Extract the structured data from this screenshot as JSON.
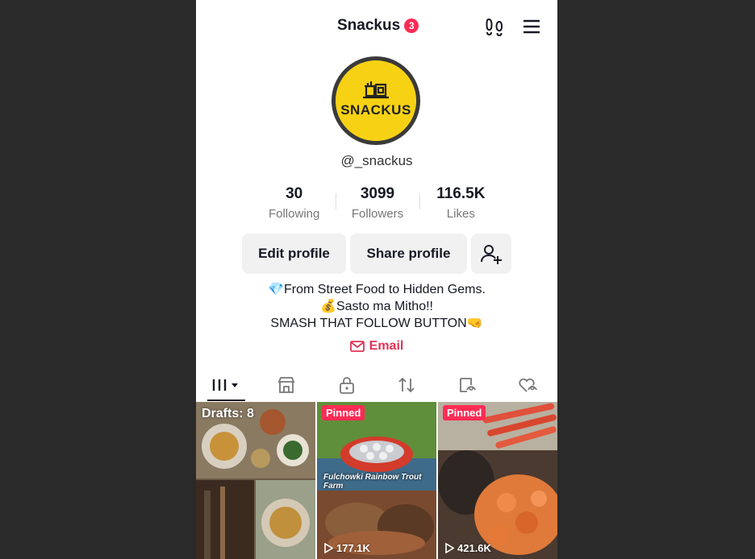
{
  "header": {
    "title": "Snackus",
    "notification_count": "3"
  },
  "profile": {
    "avatar_text": "SNACKUS",
    "handle": "@_snackus",
    "stats": [
      {
        "value": "30",
        "label": "Following"
      },
      {
        "value": "3099",
        "label": "Followers"
      },
      {
        "value": "116.5K",
        "label": "Likes"
      }
    ],
    "bio": [
      "💎From Street Food to Hidden Gems.",
      "💰Sasto ma Mitho!!",
      "SMASH THAT FOLLOW BUTTON🤜"
    ],
    "email_label": "Email"
  },
  "actions": {
    "edit_label": "Edit profile",
    "share_label": "Share profile"
  },
  "tabs": [
    {
      "icon": "grid-icon",
      "active": true
    },
    {
      "icon": "shop-icon"
    },
    {
      "icon": "lock-icon"
    },
    {
      "icon": "repost-icon"
    },
    {
      "icon": "tagged-icon"
    },
    {
      "icon": "liked-icon"
    }
  ],
  "videos": [
    {
      "drafts": "Drafts: 8"
    },
    {
      "badge": "Pinned",
      "caption": "Fulchowki Rainbow Trout Farm",
      "views": "177.1K"
    },
    {
      "badge": "Pinned",
      "views": "421.6K"
    }
  ],
  "colors": {
    "accent": "#fe2c55",
    "email": "#e23357",
    "avatar_bg": "#f7d214"
  }
}
